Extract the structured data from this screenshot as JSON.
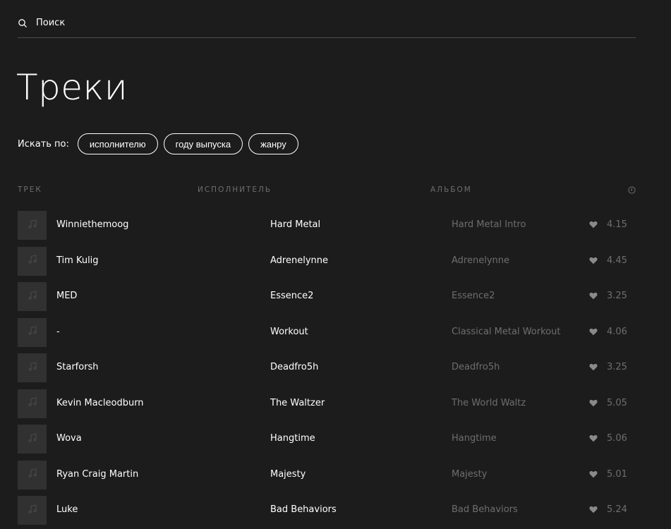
{
  "search": {
    "placeholder": "Поиск"
  },
  "title": "Треки",
  "filters": {
    "label": "Искать по:",
    "chips": [
      "исполнителю",
      "году выпуска",
      "жанру"
    ]
  },
  "table": {
    "headers": {
      "track": "ТРЕК",
      "artist": "ИСПОЛНИТЕЛЬ",
      "album": "АЛЬБОМ",
      "time_icon": "clock-icon"
    },
    "rows": [
      {
        "track": "Winniethemoog",
        "artist": "Hard Metal",
        "album": "Hard Metal Intro",
        "duration": "4.15"
      },
      {
        "track": "Tim Kulig",
        "artist": "Adrenelynne",
        "album": "Adrenelynne",
        "duration": "4.45"
      },
      {
        "track": "MED",
        "artist": "Essence2",
        "album": "Essence2",
        "duration": "3.25"
      },
      {
        "track": "-",
        "artist": "Workout",
        "album": "Classical Metal Workout",
        "duration": "4.06"
      },
      {
        "track": "Starforsh",
        "artist": "Deadfro5h",
        "album": "Deadfro5h",
        "duration": "3.25"
      },
      {
        "track": "Kevin Macleodburn",
        "artist": "The Waltzer",
        "album": "The World Waltz",
        "duration": "5.05"
      },
      {
        "track": "Wova",
        "artist": "Hangtime",
        "album": "Hangtime",
        "duration": "5.06"
      },
      {
        "track": "Ryan Craig Martin",
        "artist": "Majesty",
        "album": "Majesty",
        "duration": "5.01"
      },
      {
        "track": "Luke",
        "artist": "Bad Behaviors",
        "album": "Bad Behaviors",
        "duration": "5.24"
      }
    ]
  },
  "colors": {
    "background": "#1c1c1c",
    "text": "#ffffff",
    "muted": "#6e6e6e",
    "cover": "#313131",
    "divider": "#4e4e4e"
  },
  "icons": {
    "search": "search-icon",
    "cover": "music-note-icon",
    "like": "heart-icon",
    "time": "clock-icon"
  }
}
